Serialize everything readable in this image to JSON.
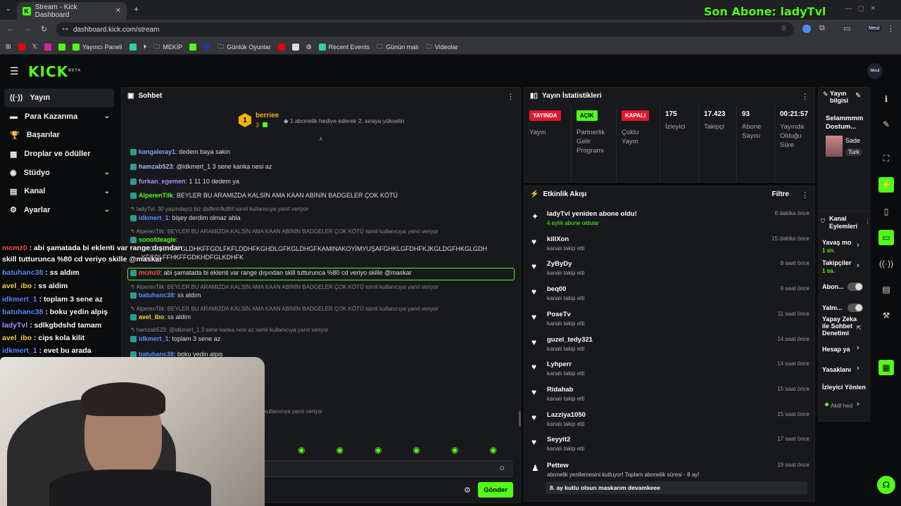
{
  "browser": {
    "tab_title": "Stream - Kick Dashboard",
    "url": "dashboard.kick.com/stream",
    "bookmarks": [
      "Yayıncı Paneli",
      "MEKİP",
      "Günlük Oyunlar",
      "Recent Events",
      "Günün malı",
      "Videolar"
    ],
    "profile": "Meut"
  },
  "overlay_banner": "Son Abone: ladyTvl",
  "logo": "KICK",
  "logo_beta": "BETA",
  "sidebar": {
    "items": [
      {
        "label": "Yayın",
        "icon": "broadcast-icon"
      },
      {
        "label": "Para Kazanma",
        "icon": "money-icon"
      },
      {
        "label": "Başarılar",
        "icon": "trophy-icon"
      },
      {
        "label": "Droplar ve ödüller",
        "icon": "gift-icon"
      },
      {
        "label": "Stüdyo",
        "icon": "studio-icon"
      },
      {
        "label": "Kanal",
        "icon": "channel-icon"
      },
      {
        "label": "Ayarlar",
        "icon": "gear-icon"
      }
    ]
  },
  "chat": {
    "title": "Sohbet",
    "gifter": {
      "name": "berriee",
      "rank": "1",
      "count": "3",
      "message": "1 abonelik hediye ederek 2. sıraya yükselin"
    },
    "messages": [
      {
        "user": "kangaleray1",
        "color": "#7aa7ff",
        "text": ": dedem baya sakin"
      },
      {
        "user": "hamzab523",
        "color": "#a3b8ff",
        "text": ": @idkmert_1 3 sene kanka nesi az"
      },
      {
        "user": "furkan_egemen",
        "color": "#b48cff",
        "text": ": 1 11 10 dedem ya"
      },
      {
        "user": "AlperenTilk",
        "color": "#53fc18",
        "text": ": BEYLER BU ARAMIZDA KALSİN AMA KAAN ABİNİN BADGELER ÇOK KÖTÜ"
      },
      {
        "reply": "ladyTvl: 30 yaşındayız biz dsifknhfkdlhf isimli kullanıcıya yanıt veriyor"
      },
      {
        "user": "idkmert_1",
        "color": "#5b8cff",
        "text": ": bişey derdim olmaz abla"
      },
      {
        "reply": "AlperenTilk: BEYLER BU ARAMIZDA KALSİN AMA KAAN ABİNİN BADGELER ÇOK KÖTÜ isimli kullanıcıya yanıt veriyor"
      },
      {
        "user": "sonofdeagle",
        "color": "#53fc18",
        "text": ":"
      },
      {
        "text": "FKGSKDHDFGLDHKFFGDLFKFLDDHFKGHDLGFKGLDHGFKAMINAKOYİMYUŞAFGHKLGFDHFKJKGLDGFHKGLGDH"
      },
      {
        "text": "KFGDLFFHKFFGDKHDFGLKDHFK"
      },
      {
        "user": "mcmz0",
        "color": "#ff4d4d",
        "text": ": abi şamatada bi eklenti var range dışından skill tutturunca %80 cd veriyo skille @maskar"
      },
      {
        "reply": "AlperenTilk: BEYLER BU ARAMIZDA KALSİN AMA KAAN ABİNİN BADGELER ÇOK KÖTÜ isimli kullanıcıya yanıt veriyor"
      },
      {
        "user": "batuhanc38",
        "color": "#5b8cff",
        "text": ": ss aldım"
      },
      {
        "reply": "AlperenTilk: BEYLER BU ARAMIZDA KALSİN AMA KAAN ABİNİN BADGELER ÇOK KÖTÜ isimli kullanıcıya yanıt veriyor"
      },
      {
        "user": "avel_ibo",
        "color": "#ffd23f",
        "text": ": ss aldim"
      },
      {
        "reply": "hamzab523: @idkmert_1 3 sene kanka nesi az isimli kullanıcıya yanıt veriyor"
      },
      {
        "user": "idkmert_1",
        "color": "#5b8cff",
        "text": ": toplam 3 sene az"
      },
      {
        "user": "batuhanc38",
        "color": "#5b8cff",
        "text": ": boku yedin alpiş"
      },
      {
        "reply": "isimli kullanıcıya yanıt veriyor"
      },
      {
        "reply": "veriyor"
      },
      {
        "reply": "AMA KAAN ABİNİN BADGELER ÇOK KÖTÜ isimli kullanıcıya yanıt veriyor"
      }
    ],
    "send_label": "Gönder"
  },
  "stats": {
    "title": "Yayın İstatistikleri",
    "items": [
      {
        "pill": "YAYINDA",
        "pill_color": "#e0182d",
        "label": "Yayın"
      },
      {
        "pill": "AÇIK",
        "pill_color": "#53fc18",
        "label": "Partnerlik Gelir Programı"
      },
      {
        "pill": "KAPALI",
        "pill_color": "#e0182d",
        "label": "Çoklu Yayın"
      },
      {
        "value": "175",
        "label": "İzleyici"
      },
      {
        "value": "17.423",
        "label": "Takipçi"
      },
      {
        "value": "93",
        "label": "Abone Sayısı"
      },
      {
        "value": "00:21:57",
        "label": "Yayında Olduğu Süre"
      }
    ]
  },
  "stream_info": {
    "title": "Yayın bilgisi",
    "text": "Selammmm Dostum...",
    "category": "Sade",
    "tag": "Turk"
  },
  "activity": {
    "title": "Etkinlik Akışı",
    "filter": "Filtre",
    "items": [
      {
        "icon": "sparkle-icon",
        "name": "ladyTvl yeniden abone oldu!",
        "sub": "4 aylık abone oldular",
        "time": "6 dakika önce"
      },
      {
        "icon": "heart-icon",
        "name": "killXon",
        "sub": "kanalı takip etti",
        "time": "15 dakika önce"
      },
      {
        "icon": "heart-icon",
        "name": "ZyByDy",
        "sub": "kanalı takip etti",
        "time": "8 saat önce"
      },
      {
        "icon": "heart-icon",
        "name": "beq00",
        "sub": "kanalı takip etti",
        "time": "9 saat önce"
      },
      {
        "icon": "heart-icon",
        "name": "PoseTv",
        "sub": "kanalı takip etti",
        "time": "11 saat önce"
      },
      {
        "icon": "heart-icon",
        "name": "guzel_tedy321",
        "sub": "kanalı takip etti",
        "time": "14 saat önce"
      },
      {
        "icon": "heart-icon",
        "name": "Lyhperr",
        "sub": "kanalı takip etti",
        "time": "14 saat önce"
      },
      {
        "icon": "heart-icon",
        "name": "Ridahab",
        "sub": "kanalı takip etti",
        "time": "15 saat önce"
      },
      {
        "icon": "heart-icon",
        "name": "Lazziya1050",
        "sub": "kanalı takip etti",
        "time": "15 saat önce"
      },
      {
        "icon": "heart-icon",
        "name": "Seyyit2",
        "sub": "kanalı takip etti",
        "time": "17 saat önce"
      }
    ],
    "last": {
      "name": "Pettew",
      "sub": "abonelik yenilemesini kutluyor! Toplam abonelik süresi - 8 ay!",
      "time": "19 saat önce",
      "msg": "8. ay kutlu olsun maskarım devamkeee"
    }
  },
  "channel_actions": {
    "title": "Kanal Eylemleri",
    "items": [
      {
        "label": "Yavaş mo",
        "sub": "1 sn."
      },
      {
        "label": "Takipçiler",
        "sub": "1 sa."
      },
      {
        "label": "Abon..."
      },
      {
        "label": "Yalnı..."
      },
      {
        "label": "Yapay Zeka ile Sohbet Denetimi"
      },
      {
        "label": "Hesap ya"
      },
      {
        "label": "Yasaklanı"
      },
      {
        "label": "İzleyici Yönlen"
      },
      {
        "label": "Aktif hed"
      }
    ]
  },
  "overlay_chat": [
    {
      "user": "mcmz0",
      "color": "#ff4d4d",
      "text": " : abi şamatada bi eklenti var range dışından"
    },
    {
      "text": "skill tutturunca %80 cd veriyo skille @maskar"
    },
    {
      "user": "batuhanc38",
      "color": "#5b8cff",
      "text": " : ss aldım"
    },
    {
      "user": "avel_ibo",
      "color": "#ffd23f",
      "text": " : ss aldim"
    },
    {
      "user": "idkmert_1",
      "color": "#5b8cff",
      "text": " : toplam 3 sene az"
    },
    {
      "user": "batuhanc38",
      "color": "#5b8cff",
      "text": " : boku yedin alpiş"
    },
    {
      "user": "ladyTvl",
      "color": "#b48cff",
      "text": " : sdlkgbdshd tamam"
    },
    {
      "user": "avel_ibo",
      "color": "#ffd23f",
      "text": " : cips kola kilit"
    },
    {
      "user": "idkmert_1",
      "color": "#5b8cff",
      "text": " : evet bu arada"
    }
  ],
  "colors": {
    "accent": "#53fc18",
    "live": "#e0182d",
    "panel": "#18191c"
  }
}
